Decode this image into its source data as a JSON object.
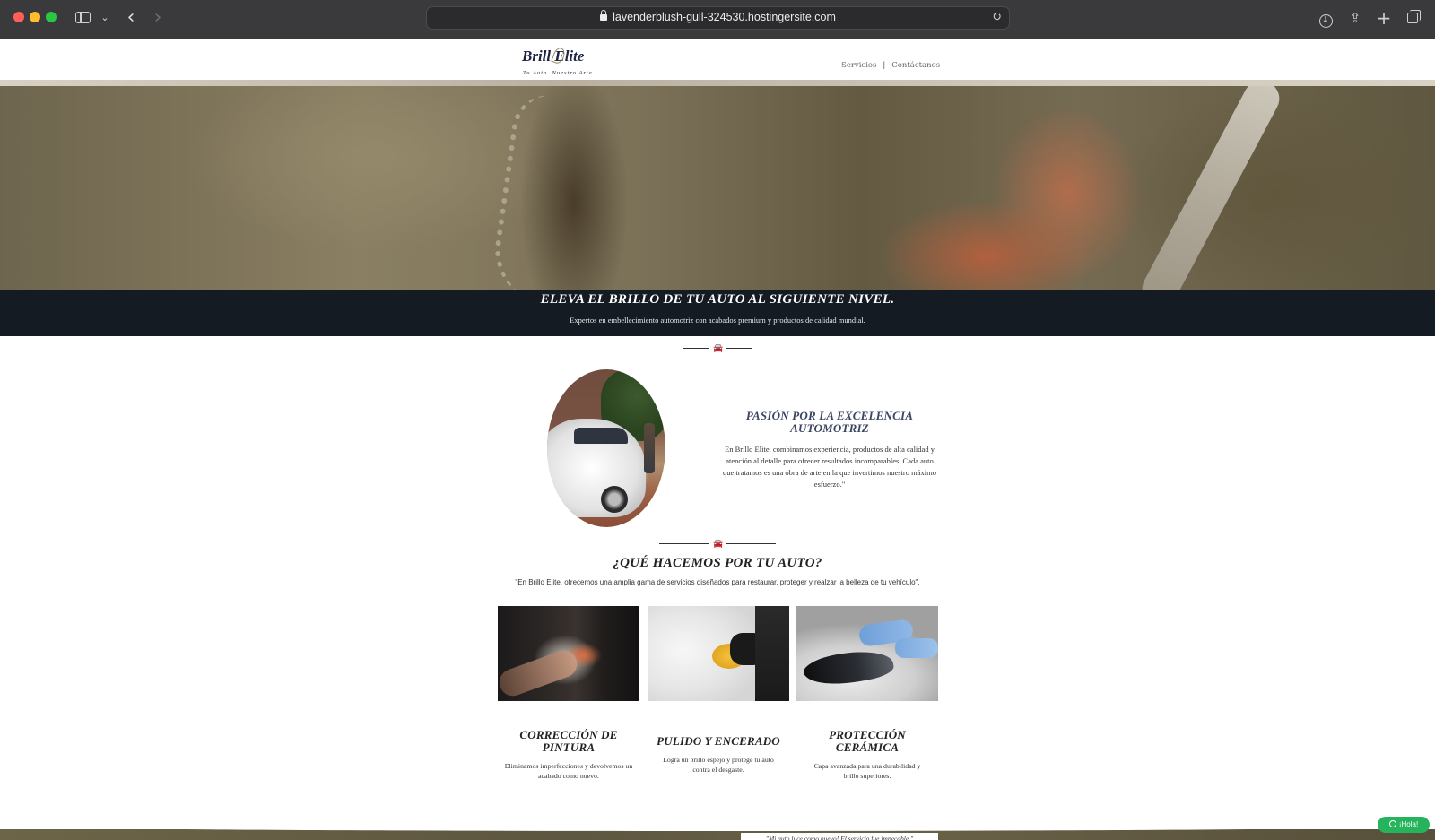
{
  "browser": {
    "url": "lavenderblush-gull-324530.hostingersite.com",
    "icons": [
      "sidebar-icon",
      "chevron-down-icon",
      "back-icon",
      "forward-icon",
      "lock-icon",
      "reload-icon",
      "download-icon",
      "share-icon",
      "new-tab-icon",
      "tab-overview-icon"
    ]
  },
  "header": {
    "logo_text": "Brill   Elite",
    "logo_tagline": "Tu Auto. Nuestro Arte.",
    "nav": [
      {
        "label": "Servicios"
      },
      {
        "label": "Contáctanos"
      }
    ],
    "nav_separator": "|"
  },
  "hero": {
    "title": "ELEVA EL BRILLO DE TU AUTO AL SIGUIENTE NIVEL.",
    "subtitle": "Expertos en embellecimiento automotriz con acabados premium y productos de calidad mundial."
  },
  "divider_icon": "car-icon",
  "about": {
    "title": "PASIÓN POR LA EXCELENCIA AUTOMOTRIZ",
    "text": "En Brillo Elite, combinamos experiencia, productos de alta calidad y atención al detalle para ofrecer resultados incomparables. Cada auto que tratamos es una obra de arte en la que invertimos nuestro máximo esfuerzo.\""
  },
  "services": {
    "title": "¿QUÉ HACEMOS POR TU AUTO?",
    "intro": "\"En Brillo Elite, ofrecemos una amplia gama de servicios diseñados para restaurar, proteger y realzar la belleza de tu vehículo\".",
    "items": [
      {
        "title": "CORRECCIÓN DE PINTURA",
        "text": "Eliminamos imperfecciones y devolvemos un acabado como nuevo."
      },
      {
        "title": "PULIDO Y ENCERADO",
        "text": "Logra un brillo espejo y protege tu auto contra el desgaste."
      },
      {
        "title": "PROTECCIÓN CERÁMICA",
        "text": "Capa avanzada para una durabilidad y brillo superiores."
      }
    ]
  },
  "testimonial_peek": "\"Mi auto luce como nuevo! El servicio fue impecable.\"",
  "whatsapp": {
    "label": "¡Hola!"
  },
  "colors": {
    "band": "#151b23",
    "accent_text": "#3a4560",
    "whatsapp": "#25b35c"
  }
}
